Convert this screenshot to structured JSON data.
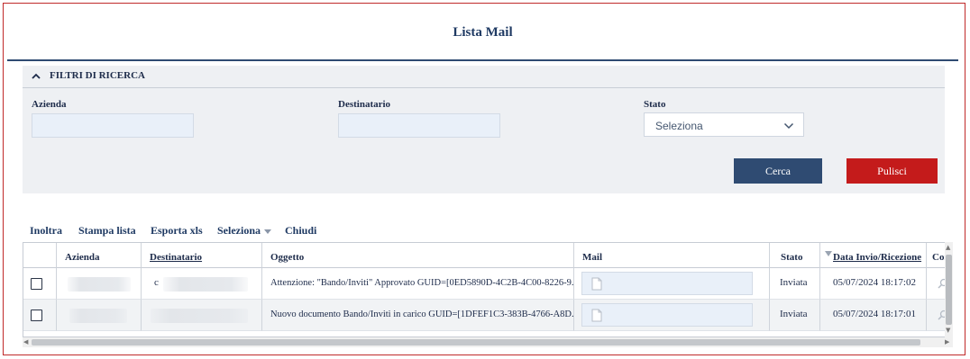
{
  "title": "Lista Mail",
  "filters": {
    "section_title": "FILTRI DI RICERCA",
    "azienda_label": "Azienda",
    "destinatario_label": "Destinatario",
    "stato_label": "Stato",
    "stato_value": "Seleziona",
    "cerca_label": "Cerca",
    "pulisci_label": "Pulisci"
  },
  "toolbar": {
    "inoltra": "Inoltra",
    "stampa": "Stampa lista",
    "esporta": "Esporta xls",
    "seleziona": "Seleziona",
    "chiudi": "Chiudi"
  },
  "table": {
    "columns": [
      "Azienda",
      "Destinatario",
      "Oggetto",
      "Mail",
      "Stato",
      "Data Invio/Ricezione",
      "Con"
    ],
    "rows": [
      {
        "azienda": "",
        "destinatario": "c",
        "oggetto": "Attenzione: \"Bando/Inviti\" Approvato GUID=[0ED5890D-4C2B-4C00-8226-9...",
        "stato": "Inviata",
        "data": "05/07/2024 18:17:02"
      },
      {
        "azienda": "",
        "destinatario": "",
        "oggetto": "Nuovo documento Bando/Inviti in carico GUID=[1DFEF1C3-383B-4766-A8D...",
        "stato": "Inviata",
        "data": "05/07/2024 18:17:01"
      }
    ]
  },
  "icons": {
    "filter_toggle": "chevron-up-icon",
    "select_dropdown": "chevron-down-icon",
    "sort": "sort-descending-icon",
    "mail_doc": "document-icon",
    "view": "search-icon"
  },
  "colors": {
    "primary": "#2f4b72",
    "danger": "#c41b1b",
    "frame_border": "#c02a2a"
  }
}
